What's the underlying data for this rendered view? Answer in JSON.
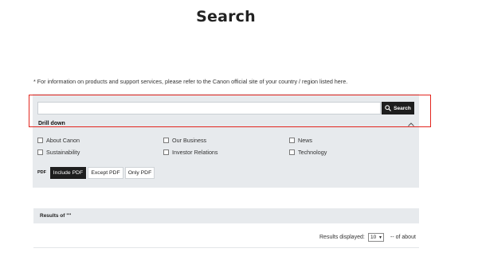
{
  "page": {
    "title": "Search"
  },
  "notice": "* For information on products and support services, please refer to the Canon official site of your country / region listed here.",
  "search": {
    "input_value": "",
    "button_label": "Search"
  },
  "drill_down": {
    "label": "Drill down",
    "categories": [
      {
        "label": "About Canon",
        "checked": false
      },
      {
        "label": "Our Business",
        "checked": false
      },
      {
        "label": "News",
        "checked": false
      },
      {
        "label": "Sustainability",
        "checked": false
      },
      {
        "label": "Investor Relations",
        "checked": false
      },
      {
        "label": "Technology",
        "checked": false
      }
    ]
  },
  "pdf": {
    "label": "PDF",
    "options": [
      {
        "label": "Include PDF",
        "active": true
      },
      {
        "label": "Except PDF",
        "active": false
      },
      {
        "label": "Only PDF",
        "active": false
      }
    ]
  },
  "results": {
    "title": "Results of \"\"",
    "displayed_label": "Results displayed:",
    "per_page_value": "10",
    "of_about": "-- of about"
  },
  "colors": {
    "highlight": "#e3261f",
    "button_dark": "#1e1e1e",
    "panel_bg": "#e7eaed"
  }
}
